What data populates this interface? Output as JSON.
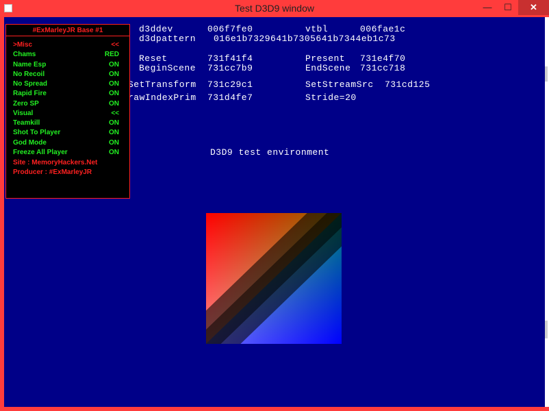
{
  "window": {
    "title": "Test D3D9 window",
    "minimize_glyph": "—",
    "maximize_glyph": "☐",
    "close_glyph": "✕",
    "icon": "app-icon"
  },
  "debug": {
    "d3ddev_label": "d3ddev",
    "d3ddev_value": "006f7fe0",
    "vtbl_label": "vtbl",
    "vtbl_value": "006fae1c",
    "d3dpattern_label": "d3dpattern",
    "d3dpattern_value": "016e1b7329641b7305641b7344eb1c73",
    "reset_label": "Reset",
    "reset_value": "731f41f4",
    "present_label": "Present",
    "present_value": "731e4f70",
    "beginscene_label": "BeginScene",
    "beginscene_value": "731cc7b9",
    "endscene_label": "EndScene",
    "endscene_value": "731cc718",
    "settransform_label": "SetTransform",
    "settransform_value": "731c29c1",
    "setstreamsrc_label": "SetStreamSrc",
    "setstreamsrc_value": "731cd125",
    "drawindexprim_label": "rawIndexPrim",
    "drawindexprim_value": "731d4fe7",
    "stride": "Stride=20",
    "env_caption": "D3D9 test environment"
  },
  "menu": {
    "title": "#ExMarleyJR Base #1",
    "items": [
      {
        "label": ">Misc",
        "value": "<<",
        "color": "#ff2020"
      },
      {
        "label": "Chams",
        "value": "RED",
        "color": "#22ee22"
      },
      {
        "label": "Name Esp",
        "value": "ON",
        "color": "#22ee22"
      },
      {
        "label": "No Recoil",
        "value": "ON",
        "color": "#22ee22"
      },
      {
        "label": "No Spread",
        "value": "ON",
        "color": "#22ee22"
      },
      {
        "label": "Rapid Fire",
        "value": "ON",
        "color": "#22ee22"
      },
      {
        "label": "Zero SP",
        "value": "ON",
        "color": "#22ee22"
      },
      {
        "label": "Visual",
        "value": "<<",
        "color": "#22ee22"
      },
      {
        "label": "Teamkill",
        "value": "ON",
        "color": "#22ee22"
      },
      {
        "label": "Shot To Player",
        "value": "ON",
        "color": "#22ee22"
      },
      {
        "label": "God Mode",
        "value": "ON",
        "color": "#22ee22"
      },
      {
        "label": "Freeze All Player",
        "value": "ON",
        "color": "#22ee22"
      }
    ],
    "site": "Site : MemoryHackers.Net",
    "producer": "Producer : #ExMarleyJR"
  },
  "colors": {
    "frame": "#ff3c3c",
    "viewport": "#000088",
    "menu_accent": "#ff2020",
    "menu_text": "#22ee22"
  }
}
